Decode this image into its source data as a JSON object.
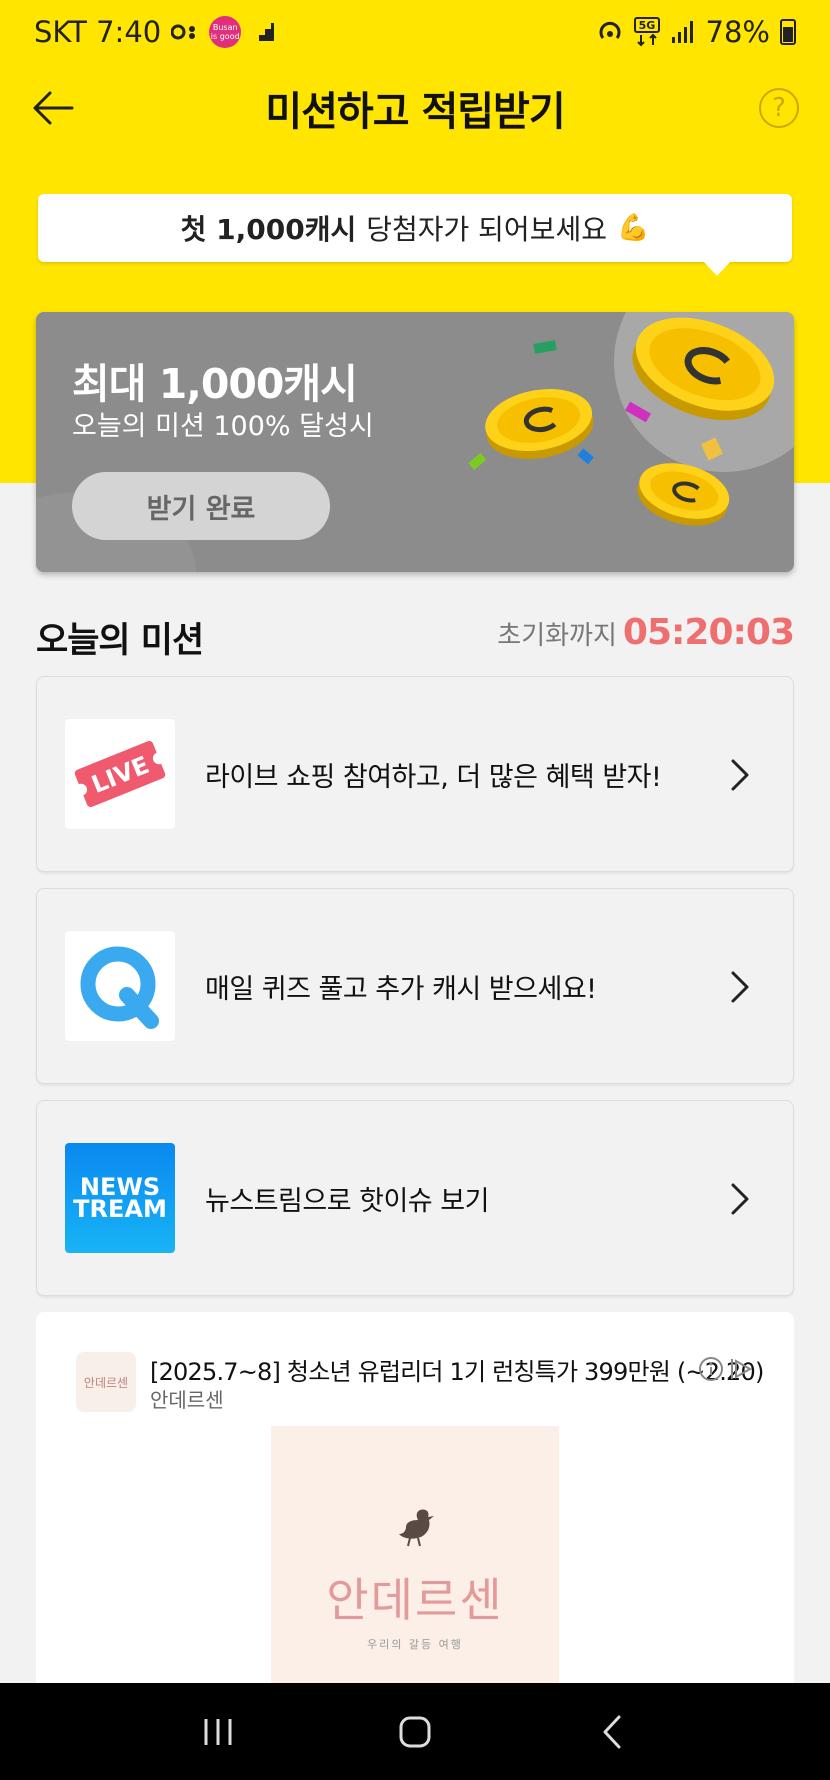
{
  "status_bar": {
    "carrier_time": "SKT 7:40",
    "busan_badge": "Busan is good",
    "network": "5G",
    "battery": "78%"
  },
  "header": {
    "title": "미션하고 적립받기",
    "help_glyph": "?"
  },
  "promo_bubble": {
    "bold": "첫 1,000캐시",
    "rest": "당첨자가 되어보세요",
    "emoji": "💪"
  },
  "reward_card": {
    "title": "최대 1,000캐시",
    "subtitle": "오늘의 미션 100% 달성시",
    "button_label": "받기 완료"
  },
  "missions_section": {
    "heading": "오늘의 미션",
    "reset_label": "초기화까지",
    "reset_timer": "05:20:03"
  },
  "missions": [
    {
      "text": "라이브 쇼핑 참여하고, 더 많은 혜택 받자!",
      "thumb_label": "LIVE",
      "icon": "live-ticket-icon"
    },
    {
      "text": "매일 퀴즈 풀고 추가 캐시 받으세요!",
      "thumb_label": "Q",
      "icon": "quiz-q-icon"
    },
    {
      "text": "뉴스트림으로 핫이슈 보기",
      "thumb_label_1": "NEWS",
      "thumb_label_2": "TREAM",
      "icon": "newstream-icon"
    }
  ],
  "ad": {
    "title": "[2025.7~8] 청소년 유럽리더 1기 런칭특가 399만원 (~2.20)",
    "brand": "안데르센",
    "logo_text": "안데르센",
    "image_name": "안데르센",
    "image_tagline": "우리의 갈등 여행"
  },
  "colors": {
    "header_yellow": "#ffe500",
    "timer_red": "#ee6f6f",
    "card_gray": "#8c8c8c"
  }
}
